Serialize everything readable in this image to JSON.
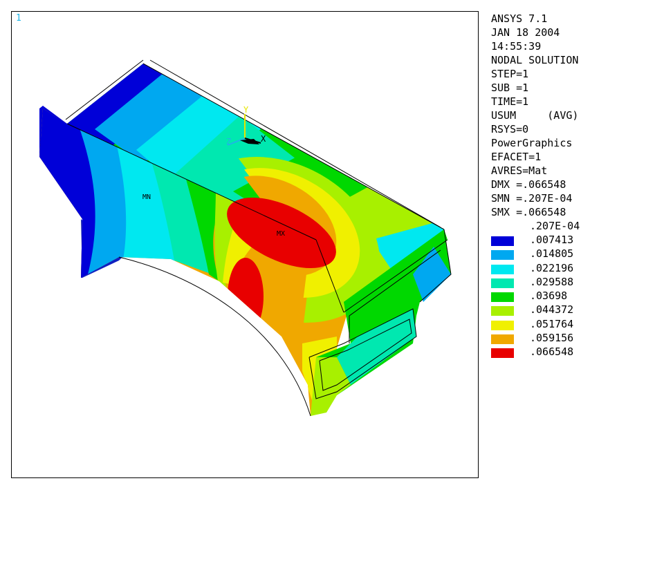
{
  "window_number": "1",
  "info_lines": [
    "ANSYS 7.1",
    "JAN 18 2004",
    "14:55:39",
    "NODAL SOLUTION",
    "STEP=1",
    "SUB =1",
    "TIME=1",
    "USUM     (AVG)",
    "RSYS=0",
    "PowerGraphics",
    "EFACET=1",
    "AVRES=Mat",
    "DMX =.066548",
    "SMN =.207E-04",
    "SMX =.066548"
  ],
  "legend": {
    "first_label": ".207E-04",
    "bands": [
      {
        "color": "#0000d8",
        "label": ".007413"
      },
      {
        "color": "#00a8f0",
        "label": ".014805"
      },
      {
        "color": "#00e8f0",
        "label": ".022196"
      },
      {
        "color": "#00e8b0",
        "label": ".029588"
      },
      {
        "color": "#00d800",
        "label": ".03698"
      },
      {
        "color": "#a8f000",
        "label": ".044372"
      },
      {
        "color": "#f0f000",
        "label": ".051764"
      },
      {
        "color": "#f0a800",
        "label": ".059156"
      },
      {
        "color": "#e80000",
        "label": ".066548"
      }
    ]
  },
  "markers": {
    "min_label": "MN",
    "max_label": "MX"
  },
  "triad": {
    "x_label": "X",
    "y_label": "Y",
    "z_label": "Z",
    "x_color": "#000000",
    "y_color": "#e6e600",
    "z_color": "#1fb5e6"
  }
}
